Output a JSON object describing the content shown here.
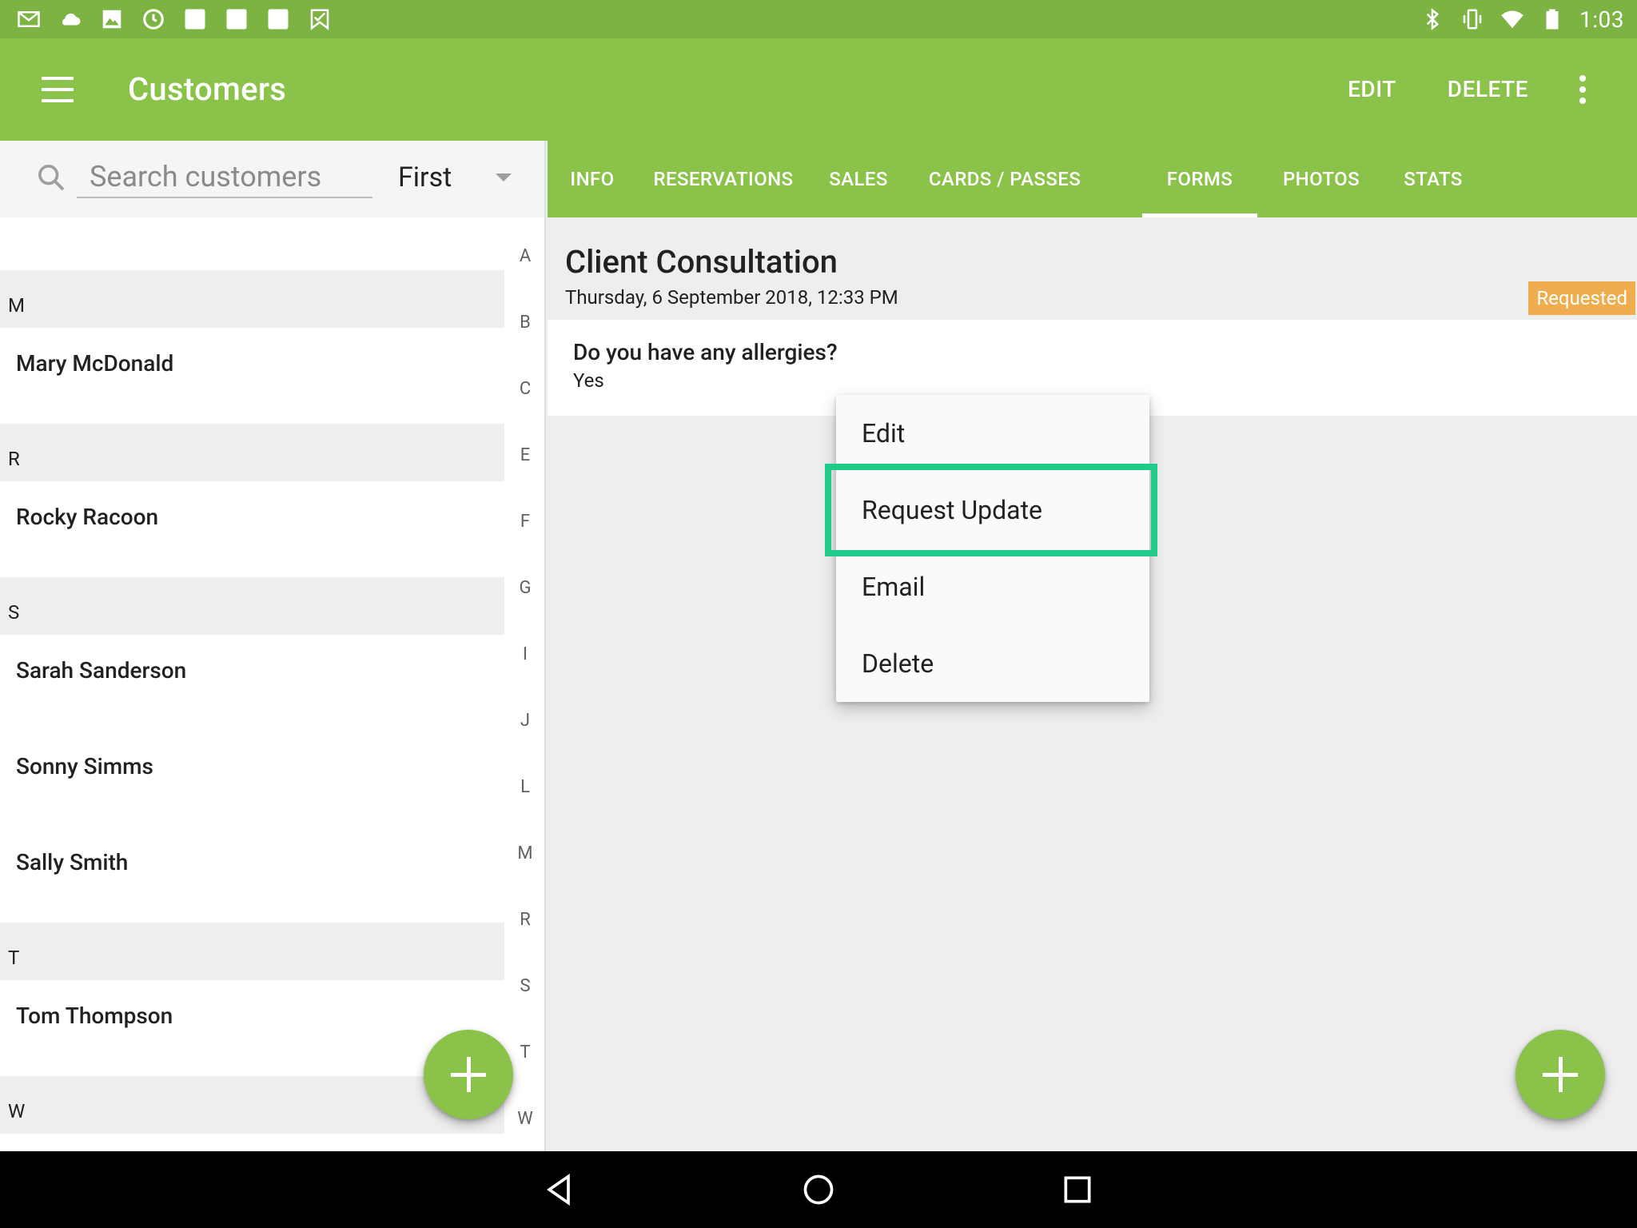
{
  "status_bar": {
    "time": "1:03",
    "left_icons": [
      "gmail-icon",
      "cloud-icon",
      "photo-icon",
      "clock-icon",
      "notification-square-icon",
      "notification-square-icon",
      "notification-square-icon",
      "check-flag-icon"
    ],
    "right_icons": [
      "bluetooth-icon",
      "vibrate-icon",
      "wifi-icon",
      "battery-icon"
    ]
  },
  "app_bar": {
    "title": "Customers",
    "actions": {
      "edit": "EDIT",
      "delete": "DELETE"
    }
  },
  "search": {
    "placeholder": "Search customers",
    "value": ""
  },
  "sort": {
    "selected": "First"
  },
  "customer_list": {
    "sections": [
      {
        "letter": "M",
        "items": [
          "Mary McDonald"
        ]
      },
      {
        "letter": "R",
        "items": [
          "Rocky Racoon"
        ]
      },
      {
        "letter": "S",
        "items": [
          "Sarah Sanderson",
          "Sonny Simms",
          "Sally Smith"
        ]
      },
      {
        "letter": "T",
        "items": [
          "Tom Thompson"
        ]
      },
      {
        "letter": "W",
        "items": []
      }
    ]
  },
  "index_rail": [
    "A",
    "B",
    "C",
    "E",
    "F",
    "G",
    "I",
    "J",
    "L",
    "M",
    "R",
    "S",
    "T",
    "W"
  ],
  "tabs": [
    {
      "label": "INFO",
      "active": false
    },
    {
      "label": "RESERVATIONS",
      "active": false
    },
    {
      "label": "SALES",
      "active": false
    },
    {
      "label": "CARDS / PASSES",
      "active": false
    },
    {
      "label": "FORMS",
      "active": true
    },
    {
      "label": "PHOTOS",
      "active": false
    },
    {
      "label": "STATS",
      "active": false
    }
  ],
  "form": {
    "title": "Client Consultation",
    "date": "Thursday, 6 September 2018, 12:33 PM",
    "status": "Requested",
    "question": "Do you have any allergies?",
    "answer": "Yes"
  },
  "context_menu": {
    "items": [
      "Edit",
      "Request Update",
      "Email",
      "Delete"
    ],
    "highlighted": "Request Update"
  },
  "colors": {
    "status_bar": "#7cb342",
    "primary": "#8bc34a",
    "badge": "#f0ad4e",
    "highlight": "#21c98a"
  }
}
